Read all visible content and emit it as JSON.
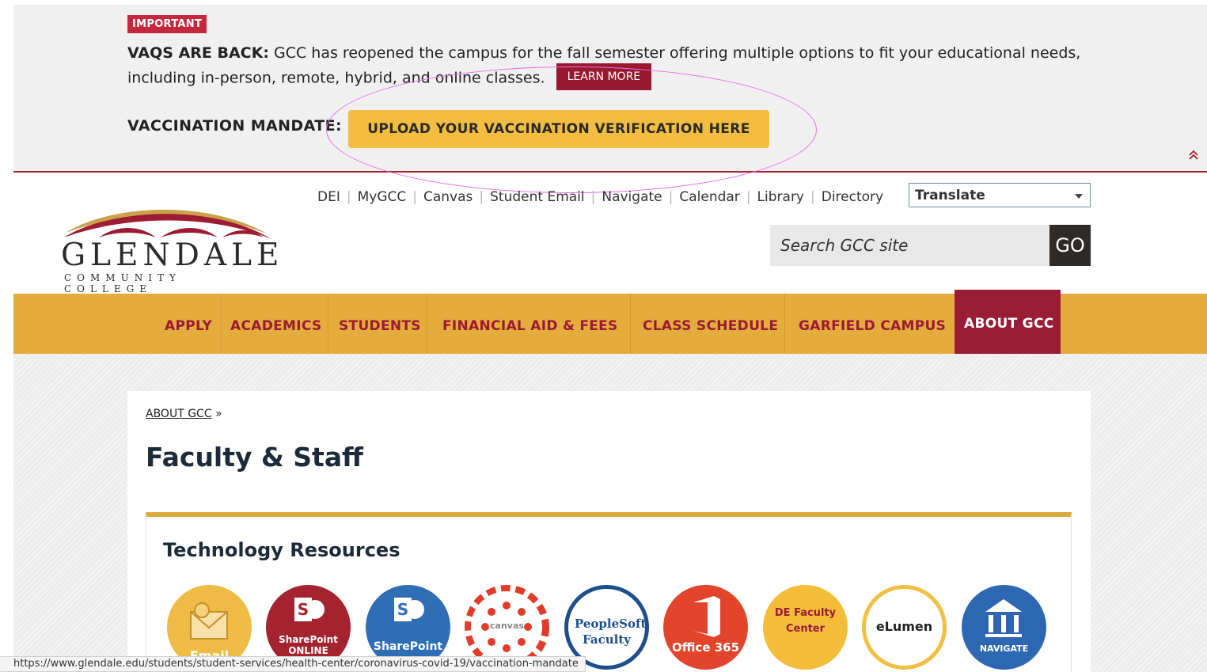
{
  "alert": {
    "badge": "IMPORTANT",
    "headline": "VAQS ARE BACK:",
    "message": "GCC has reopened the campus for the fall semester offering multiple options to fit your educational needs, including in-person, remote, hybrid, and online classes.",
    "learn_more": "LEARN MORE",
    "mandate_label": "VACCINATION MANDATE:",
    "upload_button": "UPLOAD YOUR VACCINATION VERIFICATION HERE",
    "collapse_icon": "double-chevron-up-icon"
  },
  "utility_nav": [
    "DEI",
    "MyGCC",
    "Canvas",
    "Student Email",
    "Navigate",
    "Calendar",
    "Library",
    "Directory"
  ],
  "translate": {
    "label": "Translate"
  },
  "logo": {
    "name": "GLENDALE",
    "subtitle": "COMMUNITY COLLEGE"
  },
  "search": {
    "placeholder": "Search GCC site",
    "button": "GO"
  },
  "main_nav": [
    {
      "label": "APPLY"
    },
    {
      "label": "ACADEMICS"
    },
    {
      "label": "STUDENTS"
    },
    {
      "label": "FINANCIAL AID & FEES"
    },
    {
      "label": "CLASS SCHEDULE"
    },
    {
      "label": "GARFIELD CAMPUS"
    },
    {
      "label": "ABOUT GCC",
      "active": true
    }
  ],
  "breadcrumb": {
    "link": "ABOUT GCC",
    "separator": "»"
  },
  "page_title": "Faculty & Staff",
  "panel": {
    "title": "Technology Resources",
    "apps": [
      {
        "name": "email-icon",
        "label": "Email",
        "color": "#eebc45"
      },
      {
        "name": "sharepoint-online-icon",
        "label": "SharePoint ONLINE",
        "color": "#a3242f"
      },
      {
        "name": "sharepoint-icon",
        "label": "SharePoint",
        "color": "#2f6db5"
      },
      {
        "name": "canvas-icon",
        "label": "canvas",
        "color": "#e13c2a"
      },
      {
        "name": "peoplesoft-faculty-icon",
        "label": "PeopleSoft Faculty",
        "color": "#1f4e8c"
      },
      {
        "name": "office-365-icon",
        "label": "Office 365",
        "color": "#e2452b"
      },
      {
        "name": "de-faculty-center-icon",
        "label": "DE Faculty Center",
        "color": "#f3bd3a"
      },
      {
        "name": "elumen-icon",
        "label": "eLumen",
        "color": "#f1c042"
      },
      {
        "name": "navigate-icon",
        "label": "NAVIGATE",
        "color": "#2d67b1"
      }
    ]
  },
  "status_bar": {
    "url": "https://www.glendale.edu/students/student-services/health-center/coronavirus-covid-19/vaccination-mandate"
  }
}
